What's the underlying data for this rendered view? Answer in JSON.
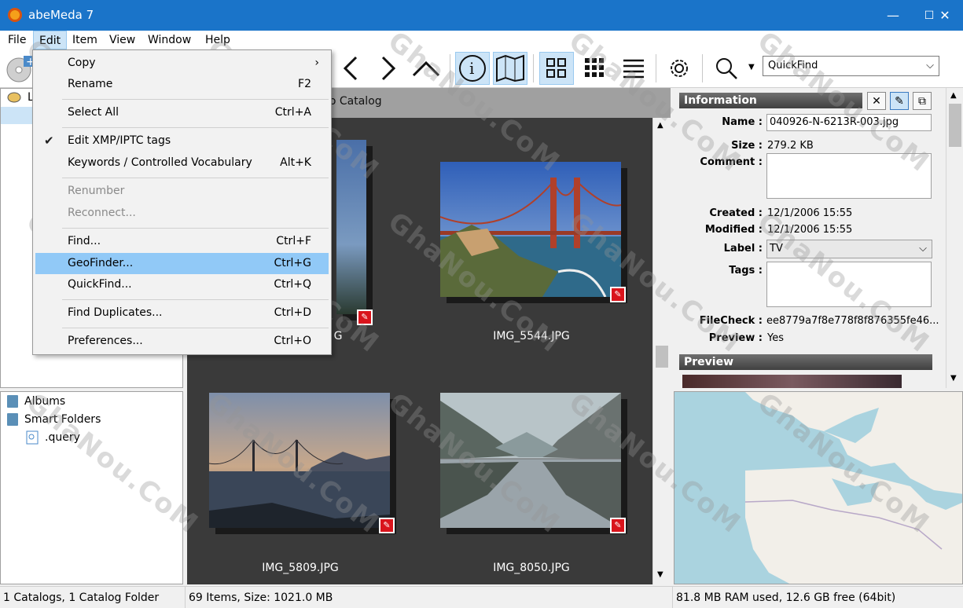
{
  "window": {
    "title": "abeMeda 7",
    "minimize": "—",
    "maximize": "☐",
    "close": "✕"
  },
  "menubar": [
    "File",
    "Edit",
    "Item",
    "View",
    "Window",
    "Help"
  ],
  "toolbar": {
    "quickfind_value": "QuickFind",
    "icons": [
      "add-catalog-icon",
      "back-icon",
      "forward-icon",
      "up-icon",
      "info-icon",
      "map-icon",
      "grid-large-icon",
      "grid-small-icon",
      "list-icon",
      "settings-icon",
      "search-icon"
    ]
  },
  "edit_menu": [
    {
      "label": "Copy",
      "shortcut": "›",
      "disabled": false
    },
    {
      "label": "Rename",
      "shortcut": "F2",
      "disabled": false
    },
    {
      "label": "Select All",
      "shortcut": "Ctrl+A",
      "disabled": false
    },
    {
      "label": "Edit XMP/IPTC tags",
      "shortcut": "",
      "checked": true
    },
    {
      "label": "Keywords / Controlled Vocabulary",
      "shortcut": "Alt+K"
    },
    {
      "label": "Renumber",
      "shortcut": "",
      "disabled": true
    },
    {
      "label": "Reconnect...",
      "shortcut": "",
      "disabled": true
    },
    {
      "label": "Find...",
      "shortcut": "Ctrl+F"
    },
    {
      "label": "GeoFinder...",
      "shortcut": "Ctrl+G",
      "highlighted": true
    },
    {
      "label": "QuickFind...",
      "shortcut": "Ctrl+Q"
    },
    {
      "label": "Find Duplicates...",
      "shortcut": "Ctrl+D"
    },
    {
      "label": "Preferences...",
      "shortcut": "Ctrl+O"
    }
  ],
  "left_tree": {
    "top_item_prefix": "L",
    "bottom_items": [
      "Albums",
      "Smart Folders",
      ".query"
    ]
  },
  "center": {
    "header_title": "no Catalog",
    "thumbnails": [
      {
        "name": "G",
        "partial": true
      },
      {
        "name": "IMG_5544.JPG"
      },
      {
        "name": "IMG_5809.JPG"
      },
      {
        "name": "IMG_8050.JPG"
      }
    ]
  },
  "info": {
    "header": "Information",
    "fields": {
      "name_label": "Name :",
      "name_value": "040926-N-6213R-003.jpg",
      "size_label": "Size :",
      "size_value": "279.2 KB",
      "comment_label": "Comment :",
      "created_label": "Created :",
      "created_value": "12/1/2006 15:55",
      "modified_label": "Modified :",
      "modified_value": "12/1/2006 15:55",
      "label_label": "Label :",
      "label_value": "TV",
      "tags_label": "Tags :",
      "filecheck_label": "FileCheck :",
      "filecheck_value": "ee8779a7f8e778f8f876355fe46...",
      "preview_label": "Preview :",
      "preview_value": "Yes"
    },
    "preview_header": "Preview"
  },
  "statusbar": {
    "left": "1 Catalogs, 1 Catalog Folder",
    "middle": "69 Items, Size: 1021.0 MB",
    "right": "81.8 MB RAM used, 12.6 GB free (64bit)"
  },
  "watermark": "GhaNou.CoM"
}
